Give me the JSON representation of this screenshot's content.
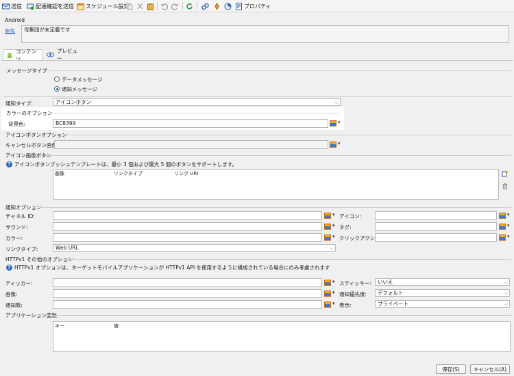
{
  "toolbar": {
    "send": "送信",
    "send_confirm": "配達確認を送信",
    "schedule": "スケジュール設定",
    "properties": "プロパティ"
  },
  "header": {
    "title": "Android",
    "recipient_link": "宛先",
    "recipient_value": "母集団が未定義です"
  },
  "tabs": [
    {
      "label": "コンテンツ",
      "icon": "android-icon"
    },
    {
      "label": "プレビュー",
      "icon": "eye-icon"
    }
  ],
  "message_type": {
    "title": "メッセージタイプ",
    "options": [
      "データメッセージ",
      "通知メッセージ"
    ],
    "selected": "通知メッセージ"
  },
  "notification_type": {
    "label": "通知タイプ:",
    "value": "アイコンボタン"
  },
  "color_options": {
    "title": "カラーのオプション",
    "bg_label": "背景色:",
    "bg_value": "BC8399"
  },
  "icon_button_options": {
    "title": "アイコンボタンオプション",
    "cancel_label": "キャンセルボタン画像:",
    "cancel_value": ""
  },
  "icon_image_buttons": {
    "title": "アイコン画像ボタン",
    "info": "アイコンボタンプッシュテンプレートは、最小 3 個および最大 5 個のボタンをサポートします。",
    "columns": [
      "画像",
      "リンクタイプ",
      "リンク URI"
    ]
  },
  "notification_options": {
    "title": "通知オプション",
    "channel_id": "チャネル ID:",
    "sound": "サウンド:",
    "color": "カラー:",
    "link_type": "リンクタイプ:",
    "link_type_value": "Web URL",
    "icon": "アイコン:",
    "tag": "タグ:",
    "click_action": "クリックアクション:"
  },
  "httpv1": {
    "title": "HTTPv1 その他のオプション",
    "info": "HTTPv1 オプションは、ターゲットモバイルアプリケーションが HTTPv1 API を使用するように構成されている場合にのみ考慮されます",
    "ticker": "ティッカー:",
    "image": "画像:",
    "count": "通知数:",
    "sticky": "スティッキー:",
    "sticky_value": "いいえ",
    "priority": "通知優先度:",
    "priority_value": "デフォルト",
    "visibility": "表示:",
    "visibility_value": "プライベート"
  },
  "app_variables": {
    "title": "アプリケーション変数",
    "columns": [
      "キー",
      "値"
    ]
  },
  "footer": {
    "save": "保存(S)",
    "cancel": "キャンセル(A)"
  }
}
